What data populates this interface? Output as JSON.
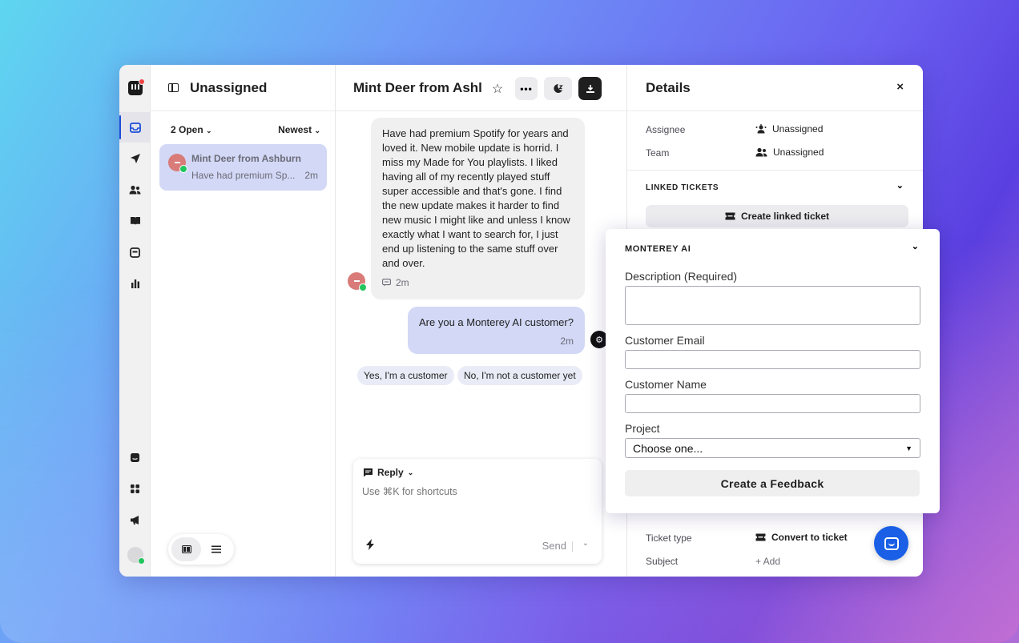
{
  "rail": {
    "icons": [
      "inbox-icon",
      "paper-plane-icon",
      "contacts-icon",
      "book-icon",
      "tickets-icon",
      "reports-icon",
      "chat-icon",
      "apps-icon",
      "megaphone-icon"
    ]
  },
  "inbox": {
    "title": "Unassigned",
    "filter_open": "2 Open",
    "filter_sort": "Newest",
    "conversation": {
      "name": "Mint Deer from Ashburn",
      "preview": "Have had premium Sp...",
      "time": "2m"
    }
  },
  "conversation": {
    "title": "Mint Deer from Ashl",
    "messages": [
      {
        "text": "Have had premium Spotify for years and loved it. New mobile update is horrid. I miss my Made for You playlists. I liked having all of my recently played stuff super accessible and that's gone. I find the new update makes it harder to find new music I might like and unless I know exactly what I want to search for, I just end up listening to the same stuff over and over.",
        "time": "2m"
      },
      {
        "text": "Are you a Monterey AI customer?",
        "time": "2m"
      }
    ],
    "quick_replies": [
      "Yes, I'm a customer",
      "No, I'm not a customer yet"
    ],
    "composer": {
      "mode": "Reply",
      "placeholder": "Use ⌘K for shortcuts",
      "send": "Send"
    }
  },
  "details": {
    "title": "Details",
    "assignee_label": "Assignee",
    "assignee_value": "Unassigned",
    "team_label": "Team",
    "team_value": "Unassigned",
    "linked_title": "LINKED TICKETS",
    "linked_button": "Create linked ticket",
    "ticket_type_label": "Ticket type",
    "ticket_type_value": "Convert to ticket",
    "subject_label": "Subject",
    "subject_value": "+ Add"
  },
  "form": {
    "title": "MONTEREY AI",
    "description_label": "Description (Required)",
    "email_label": "Customer Email",
    "name_label": "Customer Name",
    "project_label": "Project",
    "project_value": "Choose one...",
    "submit": "Create a Feedback"
  },
  "colors": {
    "accent": "#1a5fe6",
    "selected_bg": "#d2d8f6",
    "online": "#22c55e"
  }
}
